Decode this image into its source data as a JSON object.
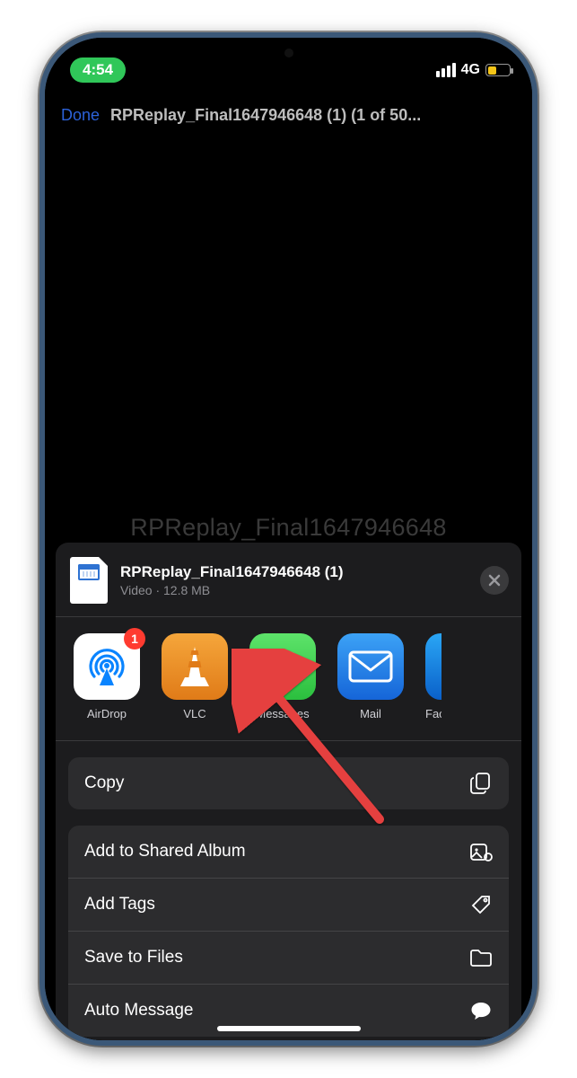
{
  "status": {
    "time": "4:54",
    "network": "4G"
  },
  "navbar": {
    "done_label": "Done",
    "title": "RPReplay_Final1647946648 (1) (1 of 50..."
  },
  "background_filename": "RPReplay_Final1647946648",
  "share": {
    "filename": "RPReplay_Final1647946648 (1)",
    "subtitle": "Video · 12.8 MB",
    "apps": [
      {
        "key": "airdrop",
        "label": "AirDrop",
        "badge": "1"
      },
      {
        "key": "vlc",
        "label": "VLC"
      },
      {
        "key": "messages",
        "label": "Messages"
      },
      {
        "key": "mail",
        "label": "Mail"
      },
      {
        "key": "extra",
        "label": "Fac"
      }
    ],
    "actions_primary": [
      {
        "key": "copy",
        "label": "Copy"
      }
    ],
    "actions_secondary": [
      {
        "key": "shared_album",
        "label": "Add to Shared Album"
      },
      {
        "key": "add_tags",
        "label": "Add Tags"
      },
      {
        "key": "save_files",
        "label": "Save to Files"
      },
      {
        "key": "auto_message",
        "label": "Auto Message"
      }
    ]
  }
}
